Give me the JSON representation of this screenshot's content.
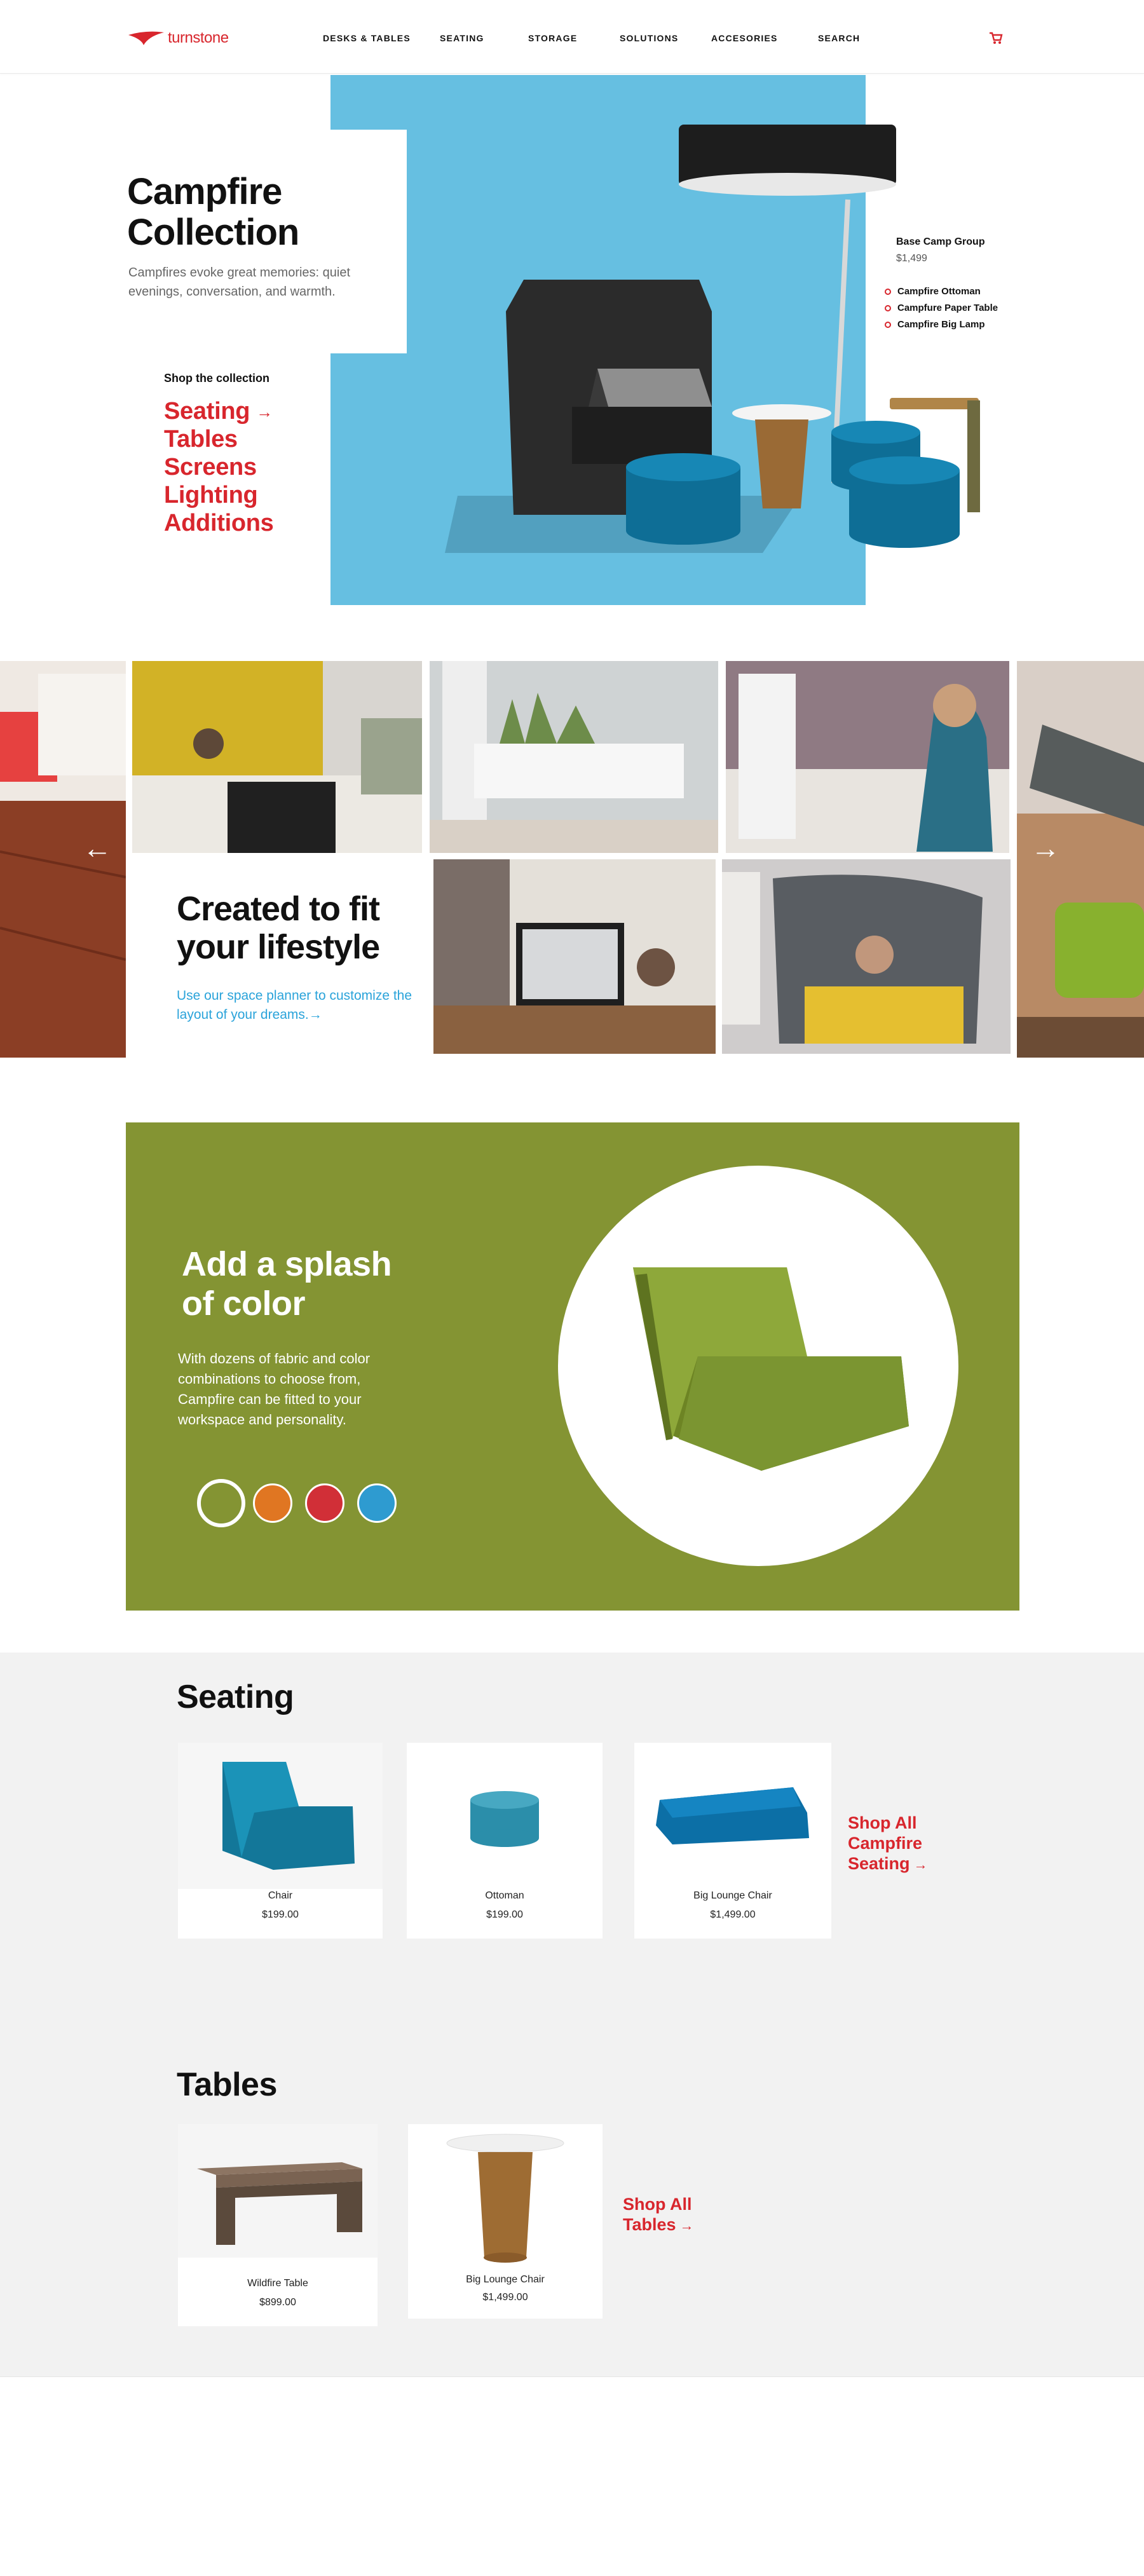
{
  "brand": {
    "name": "turnstone",
    "color": "#d8262d"
  },
  "nav": {
    "items": [
      "DESKS & TABLES",
      "SEATING",
      "STORAGE",
      "SOLUTIONS",
      "ACCESORIES",
      "SEARCH"
    ],
    "cart_icon": "shopping-cart-icon"
  },
  "hero": {
    "title": "Campfire\nCollection",
    "description": "Campfires evoke great memories: quiet evenings, conversation, and warmth.",
    "shop_label": "Shop the collection",
    "links": [
      "Seating",
      "Tables",
      "Screens",
      "Lighting",
      "Additions"
    ],
    "arrow": "→",
    "bg_color": "#66bfe1"
  },
  "product": {
    "name": "Base Camp Group",
    "price": "$1,499",
    "parts": [
      "Campfire Ottoman",
      "Campfure Paper Table",
      "Campfire Big Lamp"
    ]
  },
  "lifestyle": {
    "title": "Created to fit\nyour lifestyle",
    "link": "Use our space planner to customize the layout of your dreams.→",
    "prev_icon": "arrow-left-icon",
    "next_icon": "arrow-right-icon"
  },
  "splash": {
    "title": "Add a splash\nof color",
    "description": "With dozens of fabric and color combinations to choose from, Campfire can be fitted to your workspace and personality.",
    "bg_color": "#849433",
    "swatches": [
      "#849433",
      "#e07622",
      "#d12f37",
      "#2e9bd0"
    ],
    "selected_swatch": 0
  },
  "seating": {
    "title": "Seating",
    "items": [
      {
        "name": "Chair",
        "price": "$199.00"
      },
      {
        "name": "Ottoman",
        "price": "$199.00"
      },
      {
        "name": "Big Lounge Chair",
        "price": "$1,499.00"
      }
    ],
    "shop_all": "Shop All\nCampfire\nSeating",
    "arrow": "→"
  },
  "tables": {
    "title": "Tables",
    "items": [
      {
        "name": "Wildfire Table",
        "price": "$899.00"
      },
      {
        "name": "Big Lounge Chair",
        "price": "$1,499.00"
      }
    ],
    "shop_all": "Shop All\nTables",
    "arrow": "→"
  }
}
